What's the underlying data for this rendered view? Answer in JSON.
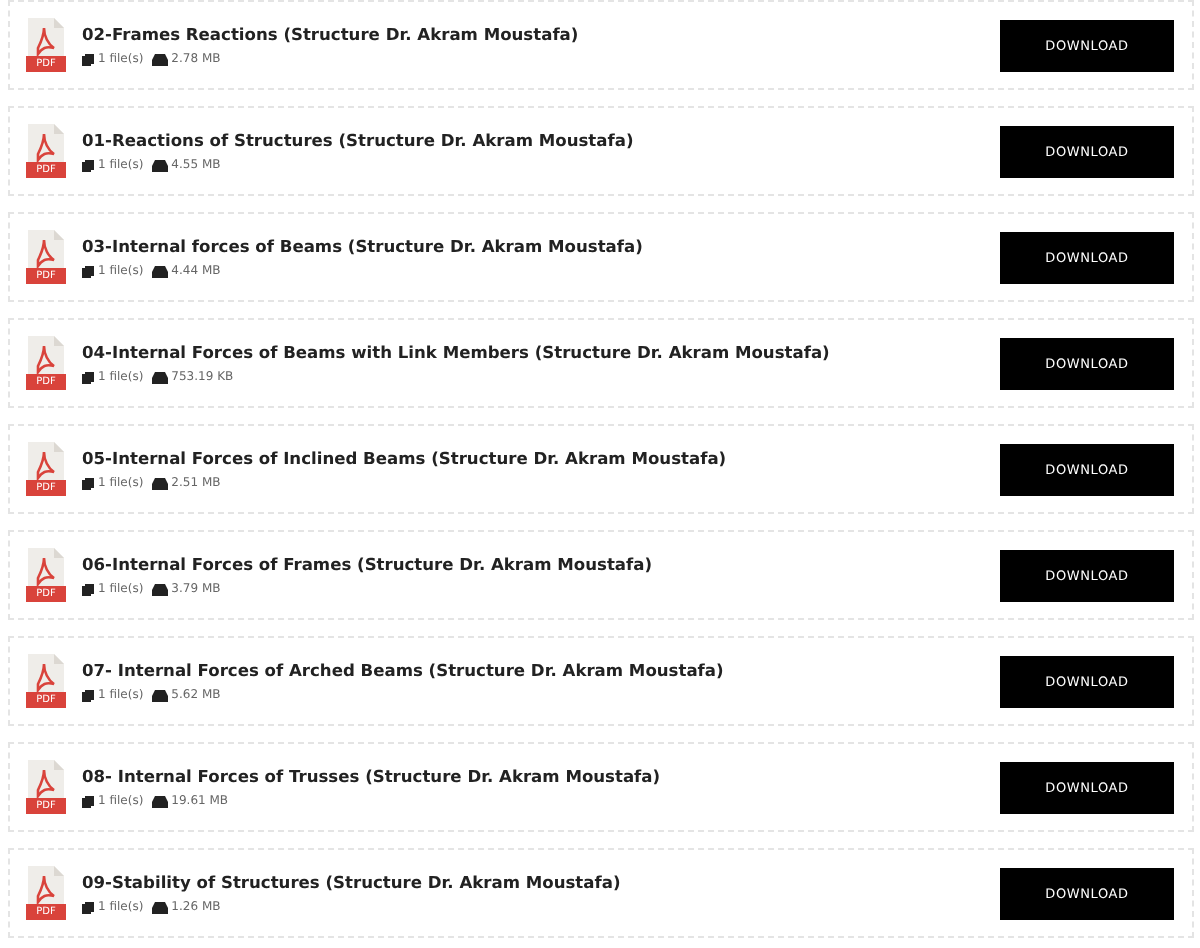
{
  "files": [
    {
      "title": "02-Frames Reactions (Structure Dr. Akram Moustafa)",
      "icon_label": "PDF",
      "count": "1 file(s)",
      "size": "2.78 MB",
      "button": "DOWNLOAD"
    },
    {
      "title": "01-Reactions of Structures (Structure Dr. Akram Moustafa)",
      "icon_label": "PDF",
      "count": "1 file(s)",
      "size": "4.55 MB",
      "button": "DOWNLOAD"
    },
    {
      "title": "03-Internal forces of Beams (Structure Dr. Akram Moustafa)",
      "icon_label": "PDF",
      "count": "1 file(s)",
      "size": "4.44 MB",
      "button": "DOWNLOAD"
    },
    {
      "title": "04-Internal Forces of Beams with Link Members (Structure Dr. Akram Moustafa)",
      "icon_label": "PDF",
      "count": "1 file(s)",
      "size": "753.19 KB",
      "button": "DOWNLOAD"
    },
    {
      "title": "05-Internal Forces of Inclined Beams (Structure Dr. Akram Moustafa)",
      "icon_label": "PDF",
      "count": "1 file(s)",
      "size": "2.51 MB",
      "button": "DOWNLOAD"
    },
    {
      "title": "06-Internal Forces of Frames (Structure Dr. Akram Moustafa)",
      "icon_label": "PDF",
      "count": "1 file(s)",
      "size": "3.79 MB",
      "button": "DOWNLOAD"
    },
    {
      "title": "07- Internal Forces of Arched Beams (Structure Dr. Akram Moustafa)",
      "icon_label": "PDF",
      "count": "1 file(s)",
      "size": "5.62 MB",
      "button": "DOWNLOAD"
    },
    {
      "title": "08- Internal Forces of Trusses (Structure Dr. Akram Moustafa)",
      "icon_label": "PDF",
      "count": "1 file(s)",
      "size": "19.61 MB",
      "button": "DOWNLOAD"
    },
    {
      "title": "09-Stability of Structures (Structure Dr. Akram Moustafa)",
      "icon_label": "PDF",
      "count": "1 file(s)",
      "size": "1.26 MB",
      "button": "DOWNLOAD"
    }
  ]
}
